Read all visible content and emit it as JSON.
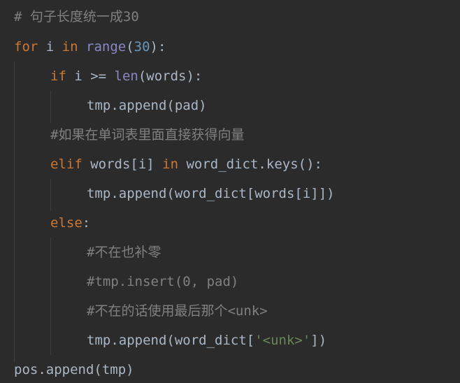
{
  "code": {
    "lines": [
      {
        "segments": [
          {
            "t": "# 句子长度统一成30",
            "c": "cmt"
          }
        ]
      },
      {
        "segments": [
          {
            "t": "for",
            "c": "kw"
          },
          {
            "t": " i ",
            "c": "plain"
          },
          {
            "t": "in",
            "c": "kw"
          },
          {
            "t": " ",
            "c": "plain"
          },
          {
            "t": "range",
            "c": "builtin"
          },
          {
            "t": "(",
            "c": "plain"
          },
          {
            "t": "30",
            "c": "num"
          },
          {
            "t": "):",
            "c": "plain"
          }
        ]
      },
      {
        "segments": [
          {
            "t": "if",
            "c": "kw"
          },
          {
            "t": " i >= ",
            "c": "plain"
          },
          {
            "t": "len",
            "c": "builtin"
          },
          {
            "t": "(words):",
            "c": "plain"
          }
        ]
      },
      {
        "segments": [
          {
            "t": "tmp.append(pad)",
            "c": "plain"
          }
        ]
      },
      {
        "segments": [
          {
            "t": "#如果在单词表里面直接获得向量",
            "c": "cmt"
          }
        ]
      },
      {
        "segments": [
          {
            "t": "elif",
            "c": "kw"
          },
          {
            "t": " words[i] ",
            "c": "plain"
          },
          {
            "t": "in",
            "c": "kw"
          },
          {
            "t": " word_dict.keys():",
            "c": "plain"
          }
        ]
      },
      {
        "segments": [
          {
            "t": "tmp.append(word_dict[words[i]])",
            "c": "plain"
          }
        ]
      },
      {
        "segments": [
          {
            "t": "else",
            "c": "kw"
          },
          {
            "t": ":",
            "c": "plain"
          }
        ]
      },
      {
        "segments": [
          {
            "t": "#不在也补零",
            "c": "cmt"
          }
        ]
      },
      {
        "segments": [
          {
            "t": "#tmp.insert(0, pad)",
            "c": "cmt"
          }
        ]
      },
      {
        "segments": [
          {
            "t": "#不在的话使用最后那个<unk>",
            "c": "cmt"
          }
        ]
      },
      {
        "segments": [
          {
            "t": "tmp.append(word_dict[",
            "c": "plain"
          },
          {
            "t": "'<unk>'",
            "c": "str"
          },
          {
            "t": "])",
            "c": "plain"
          }
        ]
      },
      {
        "segments": [
          {
            "t": "pos.append(tmp)",
            "c": "plain"
          }
        ]
      }
    ]
  },
  "colors": {
    "background": "#2b2b2b",
    "keyword": "#cc7832",
    "builtin": "#8888c6",
    "number": "#6897bb",
    "string": "#6a8759",
    "comment": "#808080",
    "plain": "#a9b7c6"
  }
}
